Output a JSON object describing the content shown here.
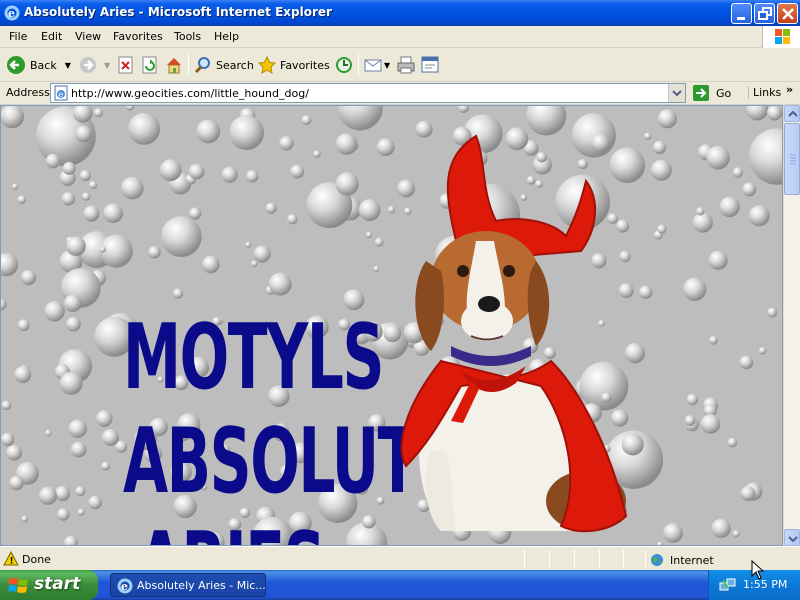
{
  "window": {
    "title": "Absolutely Aries - Microsoft Internet Explorer"
  },
  "menu": [
    "File",
    "Edit",
    "View",
    "Favorites",
    "Tools",
    "Help"
  ],
  "toolbar": {
    "back_label": "Back",
    "search_label": "Search",
    "favorites_label": "Favorites"
  },
  "address": {
    "label": "Address",
    "url": "http://www.geocities.com/little_hound_dog/",
    "go_label": "Go",
    "links_label": "Links"
  },
  "page": {
    "heading_lines": [
      "MOTYLS",
      "ABSOLUT",
      "ARIES"
    ],
    "heading_color": "#0a0a8a",
    "image_subject": "beagle dog in red devil costume with horns and cape"
  },
  "status": {
    "text": "Done",
    "zone": "Internet"
  },
  "taskbar": {
    "start_label": "start",
    "task_label": "Absolutely Aries - Mic...",
    "clock": "1:55 PM"
  },
  "colors": {
    "titlebar": "#0053e1",
    "chrome": "#ece9d8",
    "taskbar": "#2157d7",
    "start": "#3a8d3a",
    "background_pattern": "#bdbdbd",
    "costume_red": "#dd1a0a"
  }
}
